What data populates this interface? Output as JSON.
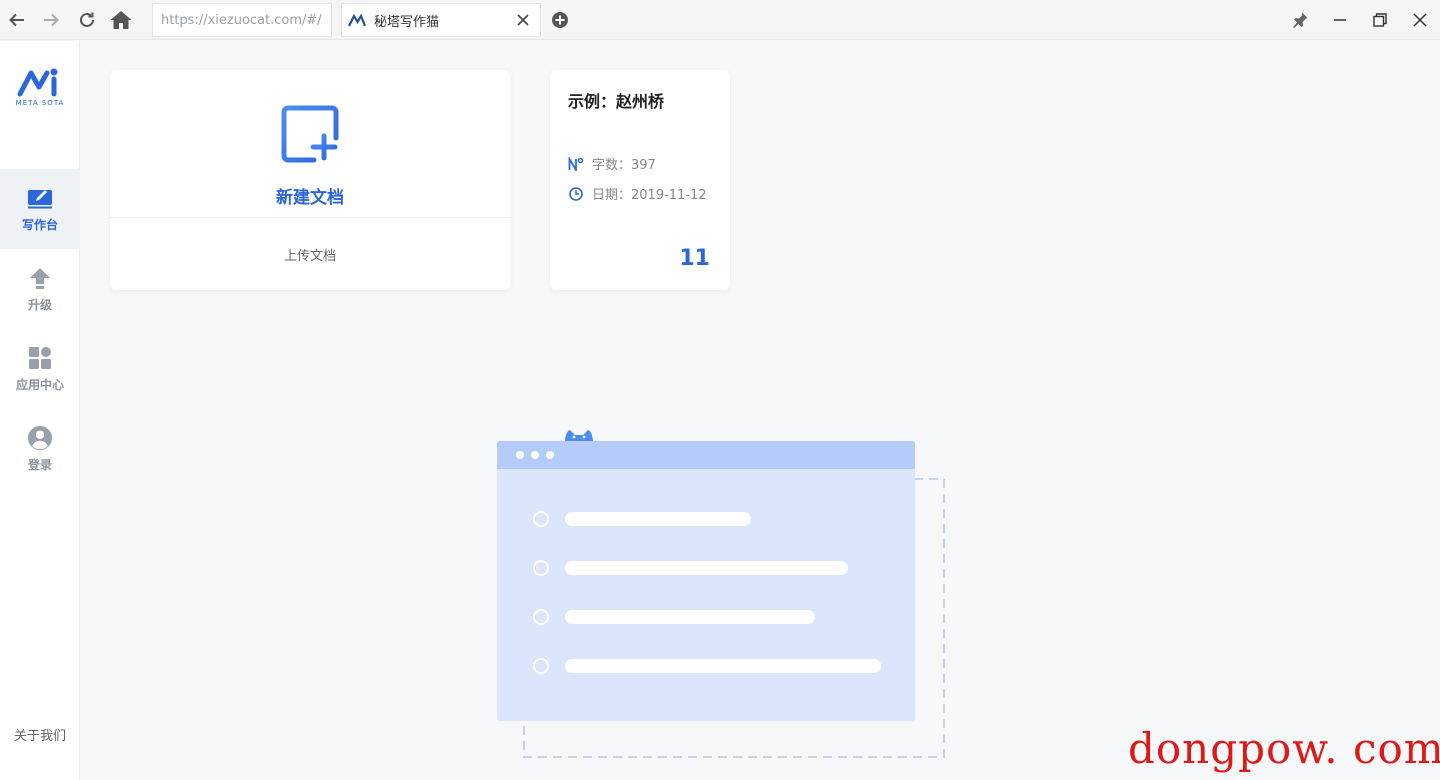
{
  "browser": {
    "url": "https://xiezuocat.com/#/",
    "tab_title": "秘塔写作猫"
  },
  "sidebar": {
    "brand_text": "META SOTA",
    "items": [
      {
        "label": "写作台",
        "icon": "edit-icon",
        "active": true
      },
      {
        "label": "升级",
        "icon": "upgrade-arrow-icon",
        "active": false
      },
      {
        "label": "应用中心",
        "icon": "apps-grid-icon",
        "active": false
      },
      {
        "label": "登录",
        "icon": "user-avatar-icon",
        "active": false
      }
    ],
    "about_label": "关于我们"
  },
  "new_card": {
    "new_label": "新建文档",
    "upload_label": "上传文档"
  },
  "doc_card": {
    "title": "示例：赵州桥",
    "word_count_label": "字数：397",
    "date_label": "日期：2019-11-12",
    "count": "11"
  },
  "watermark": "dongpow. com",
  "colors": {
    "accent": "#2b67d8",
    "background": "#f7f8fa",
    "illustration_fill": "#dbe6fd",
    "illustration_header": "#b5ccfb",
    "watermark": "#e01818"
  }
}
